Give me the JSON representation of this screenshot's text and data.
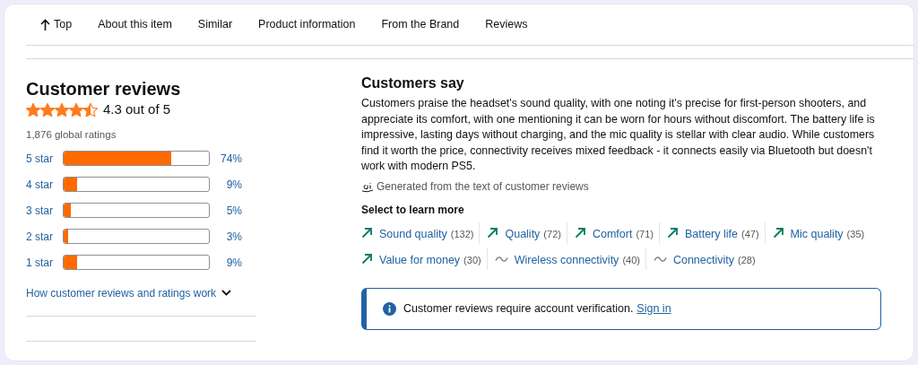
{
  "nav": [
    {
      "label": "Top",
      "kind": "top"
    },
    {
      "label": "About this item",
      "kind": "link"
    },
    {
      "label": "Similar",
      "kind": "link"
    },
    {
      "label": "Product information",
      "kind": "link"
    },
    {
      "label": "From the Brand",
      "kind": "link"
    },
    {
      "label": "Reviews",
      "kind": "link"
    }
  ],
  "reviews": {
    "title": "Customer reviews",
    "stars": 4.5,
    "rating": "4.3 out of 5",
    "total": "1,876 global ratings",
    "histogram": [
      {
        "label": "5 star",
        "level": 0.74,
        "percent": "74%"
      },
      {
        "label": "4 star",
        "level": 0.09,
        "percent": "9%"
      },
      {
        "label": "3 star",
        "level": 0.05,
        "percent": "5%"
      },
      {
        "label": "2 star",
        "level": 0.03,
        "percent": "3%"
      },
      {
        "label": "1 star",
        "level": 0.09,
        "percent": "9%"
      }
    ],
    "help_link": "How customer reviews and ratings work"
  },
  "customers_say": {
    "title": "Customers say",
    "summary": "Customers praise the headset's sound quality, with one noting it's precise for first-person shooters, and appreciate its comfort, with one mentioning it can be worn for hours without discomfort. The battery life is impressive, lasting days without charging, and the mic quality is stellar with clear audio. While customers find it worth the price, connectivity receives mixed feedback - it connects easily via Bluetooth but doesn't work with modern PS5.",
    "ai_note": "Generated from the text of customer reviews",
    "select_title": "Select to learn more",
    "aspects": [
      {
        "label": "Sound quality",
        "count": "(132)",
        "kind": "positive"
      },
      {
        "label": "Quality",
        "count": "(72)",
        "kind": "positive"
      },
      {
        "label": "Comfort",
        "count": "(71)",
        "kind": "positive"
      },
      {
        "label": "Battery life",
        "count": "(47)",
        "kind": "positive"
      },
      {
        "label": "Mic quality",
        "count": "(35)",
        "kind": "positive"
      },
      {
        "label": "Value for money",
        "count": "(30)",
        "kind": "positive"
      },
      {
        "label": "Wireless connectivity",
        "count": "(40)",
        "kind": "mixed"
      },
      {
        "label": "Connectivity",
        "count": "(28)",
        "kind": "mixed"
      }
    ]
  },
  "alert": {
    "message": "Customer reviews require account verification.",
    "link": "Sign in"
  }
}
